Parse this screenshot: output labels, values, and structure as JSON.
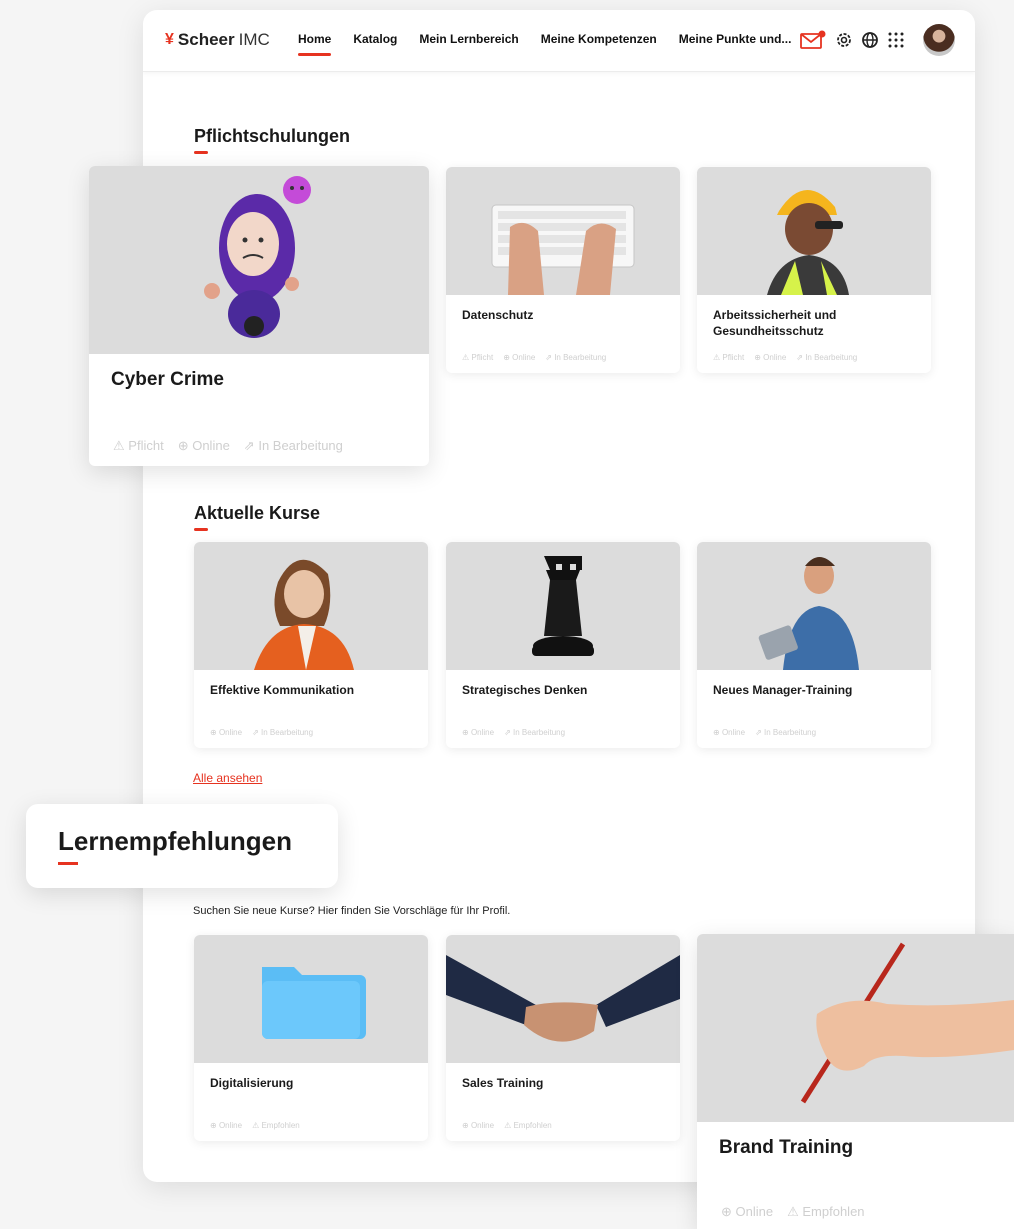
{
  "header": {
    "logo_brand": "Scheer",
    "logo_product": "IMC",
    "nav": [
      "Home",
      "Katalog",
      "Mein Lernbereich",
      "Meine Kompetenzen",
      "Meine Punkte und..."
    ]
  },
  "sections": {
    "mandatory": "Pflichtschulungen",
    "current": "Aktuelle Kurse",
    "recommendations": "Lernempfehlungen"
  },
  "mandatory_courses": [
    {
      "title": "Cyber Crime",
      "tags": [
        "Pflicht",
        "Online",
        "In Bearbeitung"
      ]
    },
    {
      "title": "Datenschutz",
      "tags": [
        "Pflicht",
        "Online",
        "In Bearbeitung"
      ]
    },
    {
      "title": "Arbeitssicherheit und Gesundheitsschutz",
      "tags": [
        "Pflicht",
        "Online",
        "In Bearbeitung"
      ]
    }
  ],
  "current_courses": [
    {
      "title": "Effektive Kommunikation",
      "tags": [
        "Online",
        "In Bearbeitung"
      ]
    },
    {
      "title": "Strategisches Denken",
      "tags": [
        "Online",
        "In Bearbeitung"
      ]
    },
    {
      "title": "Neues Manager-Training",
      "tags": [
        "Online",
        "In Bearbeitung"
      ]
    }
  ],
  "see_all": "Alle ansehen",
  "recommend_text": "Suchen Sie neue Kurse? Hier finden Sie Vorschläge für Ihr Profil.",
  "recommended_courses": [
    {
      "title": "Digitalisierung",
      "tags": [
        "Online",
        "Empfohlen"
      ]
    },
    {
      "title": "Sales Training",
      "tags": [
        "Online",
        "Empfohlen"
      ]
    },
    {
      "title": "Brand Training",
      "tags": [
        "Online",
        "Empfohlen"
      ]
    }
  ],
  "colors": {
    "accent": "#e63320",
    "image_bg": "#dcdcdc"
  }
}
